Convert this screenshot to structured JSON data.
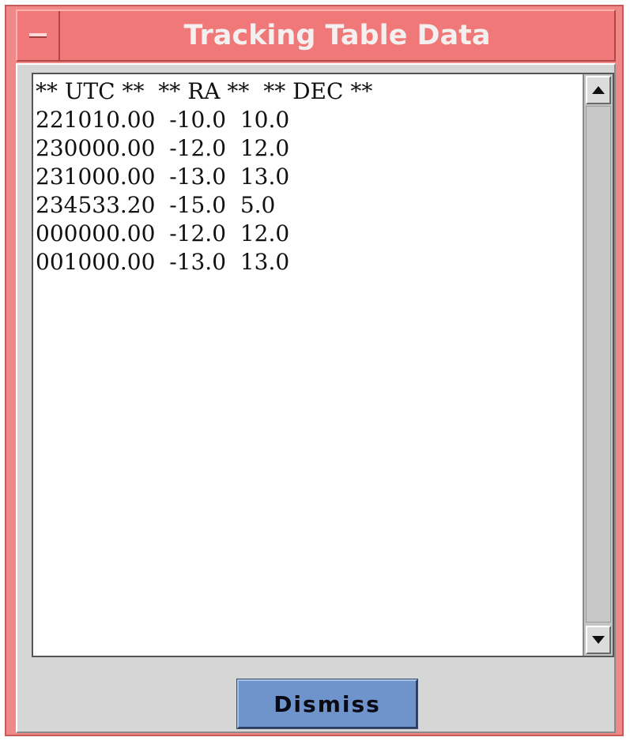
{
  "window": {
    "title": "Tracking Table Data"
  },
  "text_area": {
    "lines": [
      "** UTC **  ** RA **  ** DEC **",
      "221010.00  -10.0  10.0",
      "230000.00  -12.0  12.0",
      "231000.00  -13.0  13.0",
      "234533.20  -15.0  5.0",
      "000000.00  -12.0  12.0",
      "001000.00  -13.0  13.0"
    ]
  },
  "buttons": {
    "dismiss_label": "Dismiss"
  },
  "icons": {
    "window_menu": "window-menu-icon",
    "scroll_up": "scroll-up-arrow-icon",
    "scroll_down": "scroll-down-arrow-icon"
  },
  "colors": {
    "window_frame": "#f08888",
    "titlebar": "#f07878",
    "title_text": "#f4f0f0",
    "client_bg": "#d6d6d6",
    "dismiss_button": "#6f94cc"
  }
}
